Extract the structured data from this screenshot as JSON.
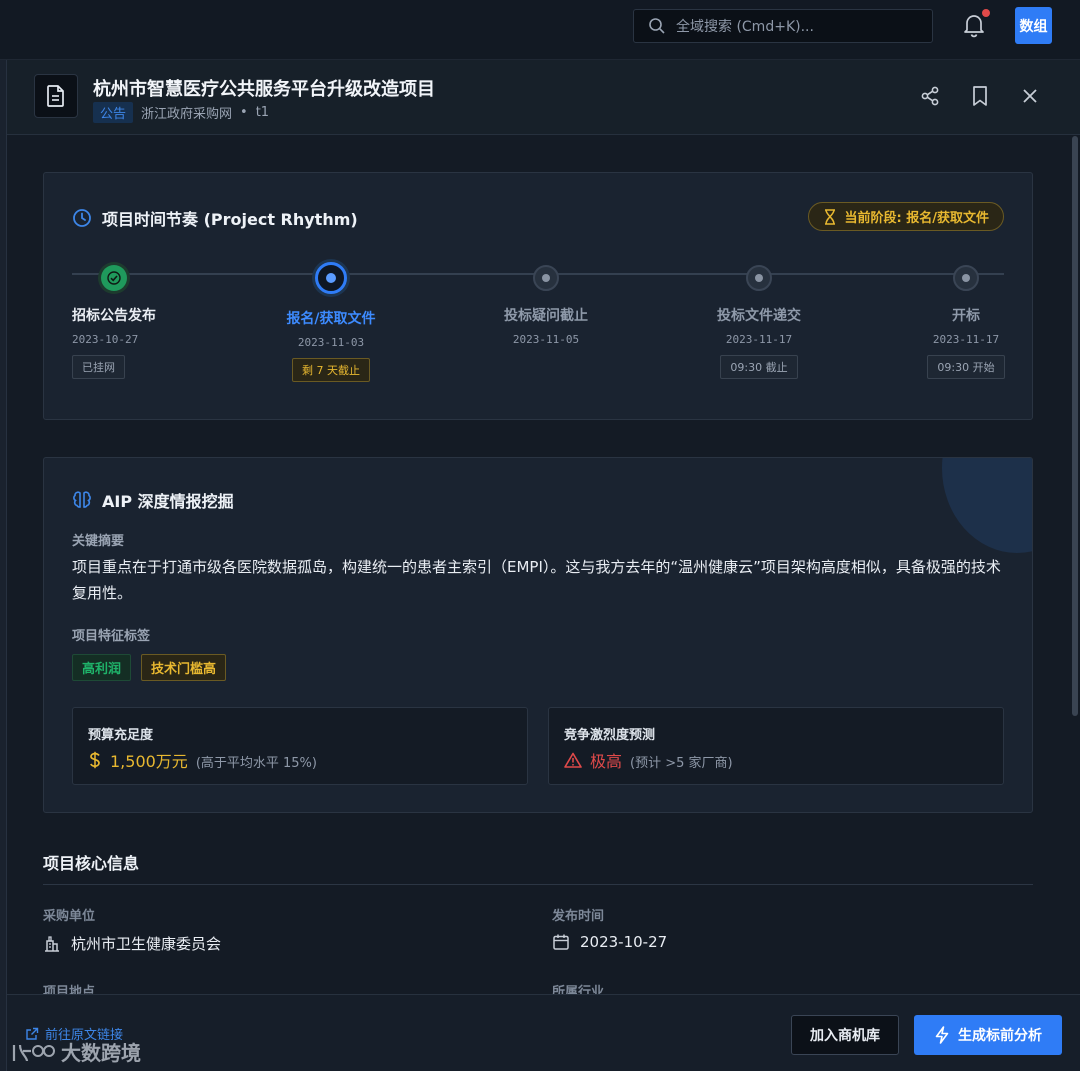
{
  "topbar": {
    "search_placeholder": "全域搜索 (Cmd+K)...",
    "avatar_label": "数组"
  },
  "project": {
    "title": "杭州市智慧医疗公共服务平台升级改造项目",
    "type_tag": "公告",
    "source": "浙江政府采购网",
    "separator": "•",
    "ref": "t1"
  },
  "rhythm": {
    "title": "项目时间节奏 (Project Rhythm)",
    "current_stage": "当前阶段: 报名/获取文件",
    "steps": [
      {
        "name": "招标公告发布",
        "date": "2023-10-27",
        "badge": "已挂网",
        "state": "done"
      },
      {
        "name": "报名/获取文件",
        "date": "2023-11-03",
        "badge": "剩 7 天截止",
        "state": "active"
      },
      {
        "name": "投标疑问截止",
        "date": "2023-11-05",
        "badge": "",
        "state": "todo"
      },
      {
        "name": "投标文件递交",
        "date": "2023-11-17",
        "badge": "09:30 截止",
        "state": "todo"
      },
      {
        "name": "开标",
        "date": "2023-11-17",
        "badge": "09:30 开始",
        "state": "todo"
      }
    ]
  },
  "aip": {
    "title": "AIP 深度情报挖掘",
    "summary_label": "关键摘要",
    "summary": "项目重点在于打通市级各医院数据孤岛，构建统一的患者主索引（EMPI）。这与我方去年的“温州健康云”项目架构高度相似，具备极强的技术复用性。",
    "tags_label": "项目特征标签",
    "tags": [
      "高利润",
      "技术门槛高"
    ],
    "budget": {
      "label": "预算充足度",
      "value": "1,500万元",
      "note": "(高于平均水平 15%)"
    },
    "competition": {
      "label": "竞争激烈度预测",
      "value": "极高",
      "note": "(预计 >5 家厂商)"
    }
  },
  "core": {
    "title": "项目核心信息",
    "buyer_label": "采购单位",
    "buyer": "杭州市卫生健康委员会",
    "publish_label": "发布时间",
    "publish": "2023-10-27",
    "location_label": "项目地点",
    "industry_label": "所属行业"
  },
  "footer": {
    "source_link": "前往原文链接",
    "watermark": "大数跨境",
    "add_button": "加入商机库",
    "analyze_button": "生成标前分析"
  },
  "colors": {
    "accent": "#2f7cf6",
    "success": "#1fb36a",
    "warning": "#e8b830",
    "danger": "#e04a4a"
  }
}
